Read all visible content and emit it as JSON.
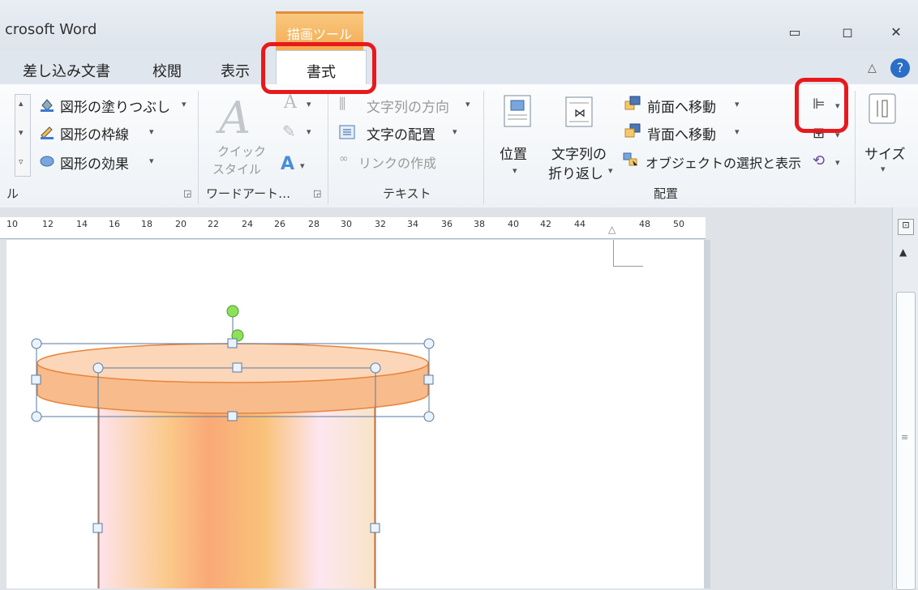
{
  "window": {
    "title": "crosoft Word",
    "context_tab": "描画ツール"
  },
  "tabs": [
    {
      "label": "差し込み文書"
    },
    {
      "label": "校閲"
    },
    {
      "label": "表示"
    },
    {
      "label": "書式"
    }
  ],
  "ribbon": {
    "shape_styles": {
      "fill": "図形の塗りつぶし",
      "outline": "図形の枠線",
      "effects": "図形の効果",
      "group_label": "ル"
    },
    "wordart": {
      "quick_style_line1": "クイック",
      "quick_style_line2": "スタイル",
      "group_label": "ワードアート…"
    },
    "text": {
      "direction": "文字列の方向",
      "align": "文字の配置",
      "link": "リンクの作成",
      "group_label": "テキスト"
    },
    "arrange": {
      "position": "位置",
      "wrap_line1": "文字列の",
      "wrap_line2": "折り返し",
      "bring_forward": "前面へ移動",
      "send_backward": "背面へ移動",
      "selection_pane": "オブジェクトの選択と表示",
      "group_label": "配置"
    },
    "size": {
      "label": "サイズ"
    }
  },
  "ruler": {
    "ticks": [
      "10",
      "12",
      "14",
      "16",
      "18",
      "20",
      "22",
      "24",
      "26",
      "28",
      "30",
      "32",
      "34",
      "36",
      "38",
      "40",
      "42",
      "44",
      "48",
      "50"
    ]
  },
  "colors": {
    "accent": "#f3a94f",
    "highlight": "#e8191c",
    "shape_top": "#f8bb8c",
    "shape_stroke": "#e8843a"
  }
}
